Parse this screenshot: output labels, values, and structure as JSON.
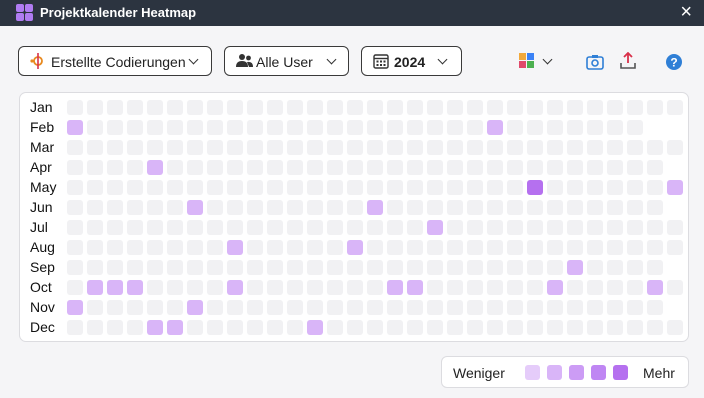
{
  "window": {
    "title": "Projektkalender Heatmap",
    "close_icon": "×"
  },
  "toolbar": {
    "metric_label": "Erstellte Codierungen",
    "user_label": "Alle User",
    "year_label": "2024"
  },
  "months": [
    "Jan",
    "Feb",
    "Mar",
    "Apr",
    "May",
    "Jun",
    "Jul",
    "Aug",
    "Sep",
    "Oct",
    "Nov",
    "Dec"
  ],
  "days_in_month": [
    31,
    29,
    31,
    30,
    31,
    30,
    31,
    31,
    30,
    31,
    30,
    31
  ],
  "heatmap": {
    "colors": [
      "#f1f1f3",
      "#e5ccfa",
      "#d9b5f8",
      "#cc9cf5",
      "#bf86f3",
      "#b570ef"
    ],
    "cells": [
      {
        "month": 2,
        "day": 1,
        "level": 2
      },
      {
        "month": 2,
        "day": 22,
        "level": 2
      },
      {
        "month": 4,
        "day": 5,
        "level": 2
      },
      {
        "month": 5,
        "day": 24,
        "level": 5
      },
      {
        "month": 5,
        "day": 31,
        "level": 2
      },
      {
        "month": 6,
        "day": 7,
        "level": 2
      },
      {
        "month": 6,
        "day": 16,
        "level": 2
      },
      {
        "month": 7,
        "day": 19,
        "level": 2
      },
      {
        "month": 8,
        "day": 9,
        "level": 2
      },
      {
        "month": 8,
        "day": 15,
        "level": 2
      },
      {
        "month": 9,
        "day": 26,
        "level": 2
      },
      {
        "month": 10,
        "day": 2,
        "level": 2
      },
      {
        "month": 10,
        "day": 3,
        "level": 2
      },
      {
        "month": 10,
        "day": 4,
        "level": 2
      },
      {
        "month": 10,
        "day": 9,
        "level": 2
      },
      {
        "month": 10,
        "day": 17,
        "level": 2
      },
      {
        "month": 10,
        "day": 18,
        "level": 2
      },
      {
        "month": 10,
        "day": 25,
        "level": 2
      },
      {
        "month": 10,
        "day": 30,
        "level": 2
      },
      {
        "month": 11,
        "day": 1,
        "level": 2
      },
      {
        "month": 11,
        "day": 7,
        "level": 2
      },
      {
        "month": 12,
        "day": 5,
        "level": 2
      },
      {
        "month": 12,
        "day": 6,
        "level": 2
      },
      {
        "month": 12,
        "day": 13,
        "level": 2
      }
    ]
  },
  "legend": {
    "less_label": "Weniger",
    "more_label": "Mehr",
    "swatches": [
      "#e5ccfa",
      "#d9b5f8",
      "#cc9cf5",
      "#bf86f3",
      "#b570ef"
    ]
  }
}
